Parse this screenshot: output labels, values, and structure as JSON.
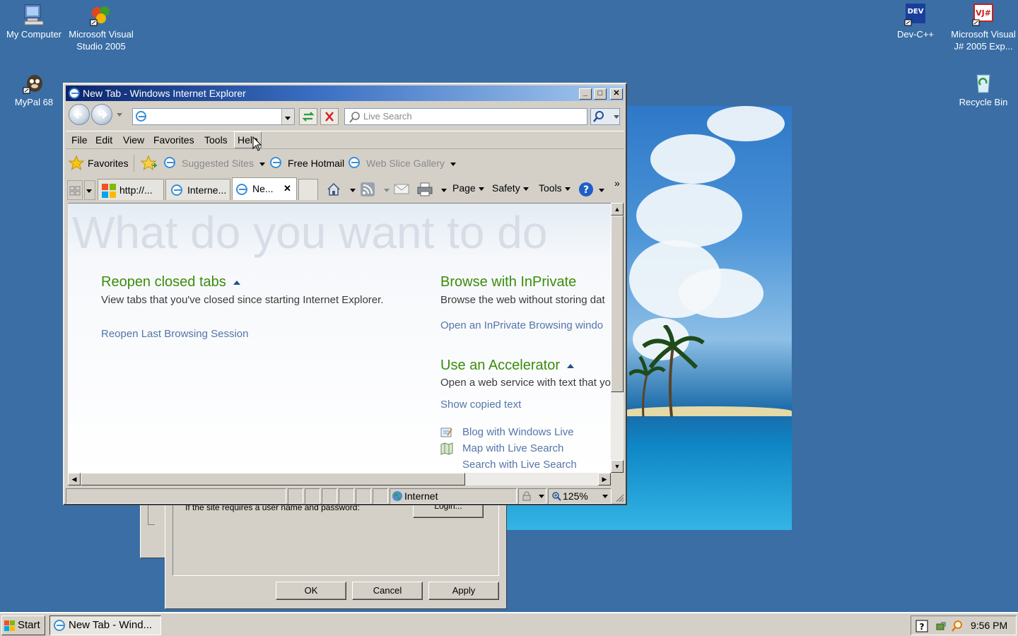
{
  "desktop": {
    "icons": [
      {
        "label_line1": "My Computer",
        "label_line2": ""
      },
      {
        "label_line1": "Microsoft Visual",
        "label_line2": "Studio 2005"
      },
      {
        "label_line1": "MyPal 68",
        "label_line2": ""
      },
      {
        "label_line1": "Dev-C++",
        "label_line2": ""
      },
      {
        "label_line1": "Microsoft Visual",
        "label_line2": "J# 2005 Exp..."
      },
      {
        "label_line1": "Recycle Bin",
        "label_line2": ""
      }
    ]
  },
  "background_dialog": {
    "text": "If the site requires a user name and password:",
    "login_button": "Login...",
    "ok_button": "OK",
    "cancel_button": "Cancel",
    "apply_button": "Apply"
  },
  "window": {
    "title": "New Tab - Windows Internet Explorer",
    "controls": {
      "minimize": "_",
      "maximize": "□",
      "close": "✕"
    },
    "address_value": "",
    "search_placeholder": "Live Search",
    "menu": [
      "File",
      "Edit",
      "View",
      "Favorites",
      "Tools",
      "Help"
    ],
    "favorites_bar": {
      "favorites_label": "Favorites",
      "suggested_sites": "Suggested Sites",
      "free_hotmail": "Free Hotmail",
      "web_slice_gallery": "Web Slice Gallery"
    },
    "tabs": [
      {
        "label": "http://...",
        "active": false
      },
      {
        "label": "Interne...",
        "active": false
      },
      {
        "label": "Ne...",
        "active": true
      }
    ],
    "command_bar": {
      "page": "Page",
      "safety": "Safety",
      "tools": "Tools",
      "overflow": "»"
    },
    "content": {
      "headline": "What do you want to do",
      "reopen": {
        "heading": "Reopen closed tabs",
        "description": "View tabs that you've closed since starting Internet Explorer.",
        "link": "Reopen Last Browsing Session"
      },
      "inprivate": {
        "heading": "Browse with InPrivate",
        "description": "Browse the web without storing dat",
        "link": "Open an InPrivate Browsing windo"
      },
      "accelerator": {
        "heading": "Use an Accelerator",
        "description": "Open a web service with text that yo",
        "link": "Show copied text",
        "items": [
          "Blog with Windows Live",
          "Map with Live Search",
          "Search with Live Search"
        ]
      }
    },
    "statusbar": {
      "zone": "Internet",
      "zoom": "125%"
    }
  },
  "taskbar": {
    "start": "Start",
    "item": "New Tab - Wind...",
    "clock": "9:56 PM"
  },
  "colors": {
    "desktop": "#3a6ea5",
    "heading_green": "#3c8c0c",
    "link_blue": "#5575a8"
  }
}
